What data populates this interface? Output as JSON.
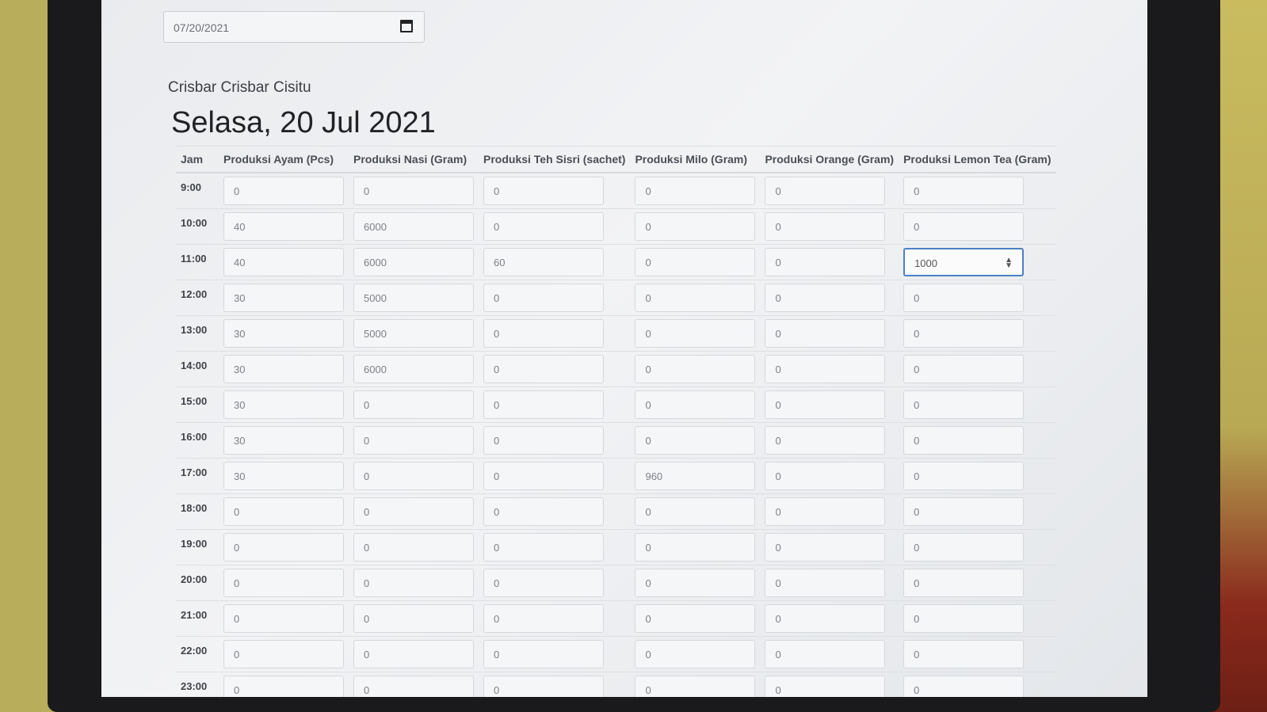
{
  "date_input": {
    "value": "07/20/2021"
  },
  "store_name": "Crisbar Crisbar Cisitu",
  "page_title": "Selasa, 20 Jul 2021",
  "table": {
    "headers": [
      "Jam",
      "Produksi Ayam (Pcs)",
      "Produksi Nasi (Gram)",
      "Produksi Teh Sisri (sachet)",
      "Produksi Milo (Gram)",
      "Produksi Orange (Gram)",
      "Produksi Lemon Tea (Gram)"
    ],
    "rows": [
      {
        "time": "9:00",
        "values": [
          "0",
          "0",
          "0",
          "0",
          "0",
          "0"
        ]
      },
      {
        "time": "10:00",
        "values": [
          "40",
          "6000",
          "0",
          "0",
          "0",
          "0"
        ]
      },
      {
        "time": "11:00",
        "values": [
          "40",
          "6000",
          "60",
          "0",
          "0",
          "1000"
        ]
      },
      {
        "time": "12:00",
        "values": [
          "30",
          "5000",
          "0",
          "0",
          "0",
          "0"
        ]
      },
      {
        "time": "13:00",
        "values": [
          "30",
          "5000",
          "0",
          "0",
          "0",
          "0"
        ]
      },
      {
        "time": "14:00",
        "values": [
          "30",
          "6000",
          "0",
          "0",
          "0",
          "0"
        ]
      },
      {
        "time": "15:00",
        "values": [
          "30",
          "0",
          "0",
          "0",
          "0",
          "0"
        ]
      },
      {
        "time": "16:00",
        "values": [
          "30",
          "0",
          "0",
          "0",
          "0",
          "0"
        ]
      },
      {
        "time": "17:00",
        "values": [
          "30",
          "0",
          "0",
          "960",
          "0",
          "0"
        ]
      },
      {
        "time": "18:00",
        "values": [
          "0",
          "0",
          "0",
          "0",
          "0",
          "0"
        ]
      },
      {
        "time": "19:00",
        "values": [
          "0",
          "0",
          "0",
          "0",
          "0",
          "0"
        ]
      },
      {
        "time": "20:00",
        "values": [
          "0",
          "0",
          "0",
          "0",
          "0",
          "0"
        ]
      },
      {
        "time": "21:00",
        "values": [
          "0",
          "0",
          "0",
          "0",
          "0",
          "0"
        ]
      },
      {
        "time": "22:00",
        "values": [
          "0",
          "0",
          "0",
          "0",
          "0",
          "0"
        ]
      },
      {
        "time": "23:00",
        "values": [
          "0",
          "0",
          "0",
          "0",
          "0",
          "0"
        ]
      }
    ]
  },
  "icons": {
    "date_picker": "calendar-icon",
    "stepper": "spinner-icon"
  }
}
